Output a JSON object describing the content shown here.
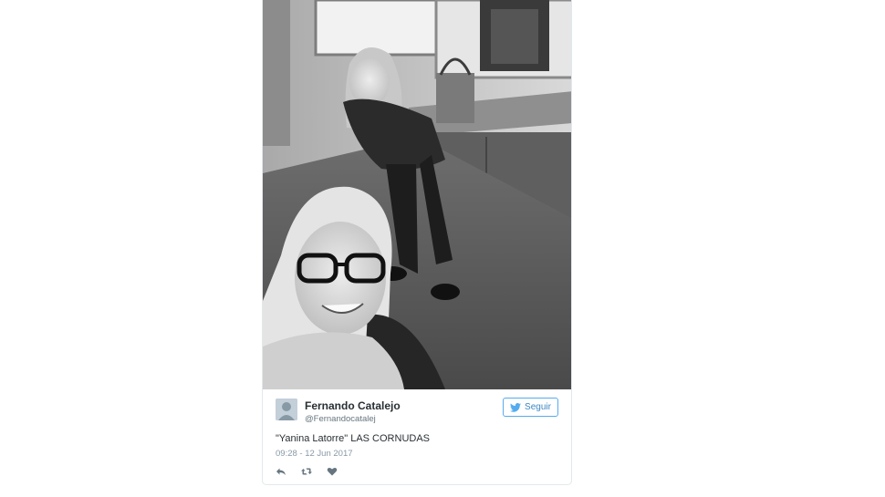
{
  "tweet": {
    "author_name": "Fernando Catalejo",
    "author_handle": "@Fernandocatalej",
    "follow_label": "Seguir",
    "text": "\"Yanina Latorre\" LAS CORNUDAS",
    "timestamp": "09:28 - 12 Jun 2017",
    "photo_icon": "photo-selfie",
    "actions": [
      "reply-icon",
      "retweet-icon",
      "like-icon"
    ]
  },
  "colors": {
    "accent": "#55acee",
    "text": "#292f33",
    "muted": "#8899a6"
  }
}
